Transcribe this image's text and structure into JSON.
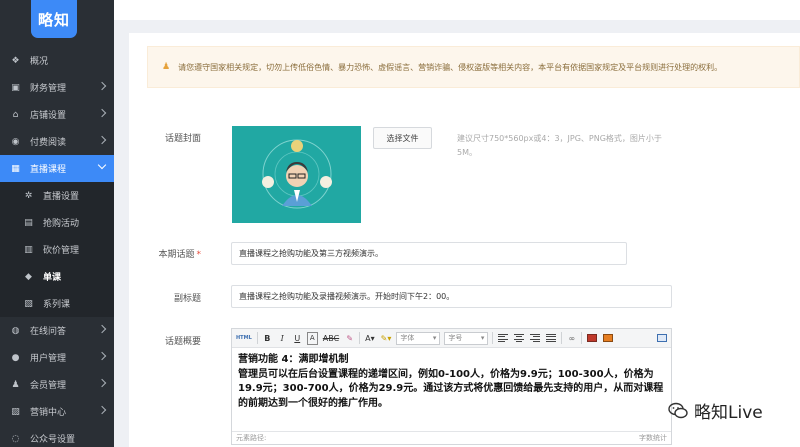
{
  "logo": "略知",
  "sidebar": {
    "items": [
      {
        "label": "概况",
        "icon": "layers-icon",
        "glyph": "❖",
        "arrow": false
      },
      {
        "label": "财务管理",
        "icon": "finance-icon",
        "glyph": "▣",
        "arrow": true
      },
      {
        "label": "店铺设置",
        "icon": "shop-icon",
        "glyph": "⌂",
        "arrow": true
      },
      {
        "label": "付费阅读",
        "icon": "paid-read-icon",
        "glyph": "◉",
        "arrow": true
      }
    ],
    "active": {
      "label": "直播课程",
      "icon": "live-icon",
      "glyph": "▦"
    },
    "sub": [
      {
        "label": "直播设置",
        "icon": "gear-icon",
        "glyph": "✲"
      },
      {
        "label": "抢购活动",
        "icon": "flash-sale-icon",
        "glyph": "▤"
      },
      {
        "label": "砍价管理",
        "icon": "bargain-icon",
        "glyph": "▥"
      },
      {
        "label": "单课",
        "icon": "tag-icon",
        "glyph": "◆"
      },
      {
        "label": "系列课",
        "icon": "series-icon",
        "glyph": "▧"
      }
    ],
    "bottom": [
      {
        "label": "在线问答",
        "icon": "qa-icon",
        "glyph": "◍",
        "arrow": true
      },
      {
        "label": "用户管理",
        "icon": "user-icon",
        "glyph": "●",
        "arrow": true
      },
      {
        "label": "会员管理",
        "icon": "member-icon",
        "glyph": "♟",
        "arrow": true
      },
      {
        "label": "营销中心",
        "icon": "marketing-icon",
        "glyph": "▨",
        "arrow": true
      },
      {
        "label": "公众号设置",
        "icon": "wechat-icon",
        "glyph": "◌",
        "arrow": false
      }
    ]
  },
  "notice": "请您遵守国家相关规定，切勿上传低俗色情、暴力恐怖、虚假谣言、营销诈骗、侵权盗版等相关内容，本平台有依据国家规定及平台规则进行处理的权利。",
  "form": {
    "cover_label": "话题封面",
    "choose_file": "选择文件",
    "cover_hint": "建议尺寸750*560px或4：3，JPG、PNG格式，图片小于5M。",
    "title_label": "本期话题",
    "title_required": "*",
    "title_value": "直播课程之抢购功能及第三方视频演示。",
    "subtitle_label": "副标题",
    "subtitle_value": "直播课程之抢购功能及录播视频演示。开始时间下午2：00。",
    "summary_label": "话题概要"
  },
  "editor": {
    "html_btn": "HTML",
    "font_placeholder": "字体",
    "size_placeholder": "字号",
    "content_line1": "营销功能 4：满即增机制",
    "content_line2": "管理员可以在后台设置课程的递增区间，例如0-100人，价格为9.9元；100-300人，价格为19.9元；300-700人，价格为29.9元。通过该方式将优惠回馈给最先支持的用户，从而对课程的前期达到一个很好的推广作用。",
    "path_label": "元素路径:",
    "word_count": "字数统计"
  },
  "watermark": "略知Live",
  "colors": {
    "accent": "#3d8af7",
    "sidebar": "#2a2f35",
    "cover": "#21a8a3"
  }
}
